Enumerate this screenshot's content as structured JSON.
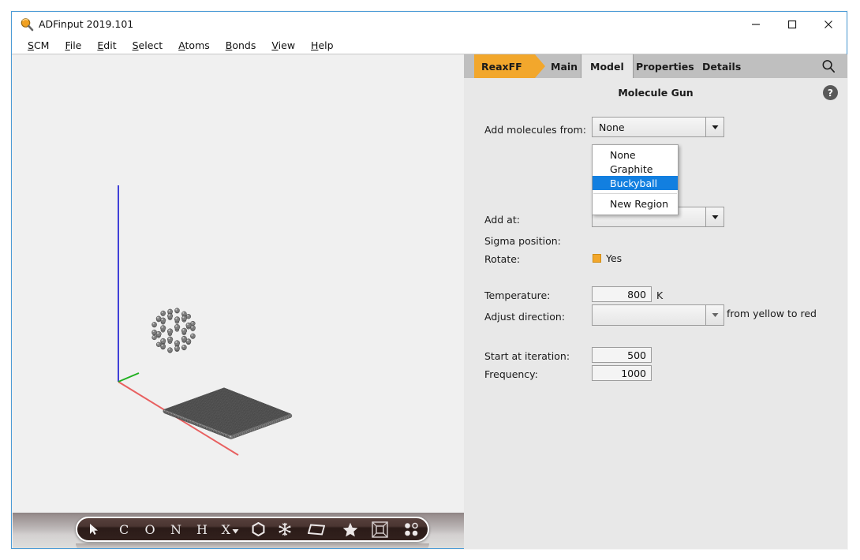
{
  "window": {
    "title": "ADFinput 2019.101",
    "icon": "magnifier-icon",
    "minimize_label": "–",
    "maximize_label": "□",
    "close_label": "✕"
  },
  "menubar": {
    "items": [
      {
        "label": "SCM",
        "mnemonic": "S"
      },
      {
        "label": "File",
        "mnemonic": "F"
      },
      {
        "label": "Edit",
        "mnemonic": "E"
      },
      {
        "label": "Select",
        "mnemonic": "S"
      },
      {
        "label": "Atoms",
        "mnemonic": "A"
      },
      {
        "label": "Bonds",
        "mnemonic": "B"
      },
      {
        "label": "View",
        "mnemonic": "V"
      },
      {
        "label": "Help",
        "mnemonic": "H"
      }
    ]
  },
  "tabs": {
    "module_label": "ReaxFF",
    "module_color": "#f2a72c",
    "items": [
      {
        "label": "Main",
        "active": false
      },
      {
        "label": "Model",
        "active": true
      },
      {
        "label": "Properties",
        "active": false
      },
      {
        "label": "Details",
        "active": false
      }
    ],
    "search_icon": "search-icon"
  },
  "panel": {
    "title": "Molecule Gun",
    "help_label": "?",
    "fields": {
      "add_molecules_from": {
        "label": "Add molecules from:",
        "value": "None"
      },
      "add_at": {
        "label": "Add at:",
        "value": ""
      },
      "sigma_position": {
        "label": "Sigma position:",
        "value": ""
      },
      "rotate": {
        "label": "Rotate:",
        "value": "Yes",
        "checked": true,
        "check_color": "#f2a72c"
      },
      "temperature": {
        "label": "Temperature:",
        "value": "800",
        "unit": "K"
      },
      "adjust_direction": {
        "label": "Adjust direction:",
        "value": "",
        "hint": "from yellow to red"
      },
      "start_at_iteration": {
        "label": "Start at iteration:",
        "value": "500"
      },
      "frequency": {
        "label": "Frequency:",
        "value": "1000"
      }
    }
  },
  "dropdown": {
    "open": true,
    "highlight_color": "#127fe0",
    "options": [
      {
        "label": "None",
        "selected": false
      },
      {
        "label": "Graphite",
        "selected": false
      },
      {
        "label": "Buckyball",
        "selected": true
      },
      {
        "label": "New Region",
        "selected": false,
        "after_separator": true
      }
    ]
  },
  "toolbar": {
    "buttons": [
      {
        "name": "select-cursor-icon",
        "label": "➤"
      },
      {
        "name": "element-c-button",
        "label": "C"
      },
      {
        "name": "element-o-button",
        "label": "O"
      },
      {
        "name": "element-n-button",
        "label": "N"
      },
      {
        "name": "element-h-button",
        "label": "H"
      },
      {
        "name": "element-x-dropdown-button",
        "label": "X"
      },
      {
        "name": "ring-hexagon-icon",
        "label": "⬡"
      },
      {
        "name": "snowflake-icon",
        "label": "✸"
      },
      {
        "name": "plane-parallelogram-icon",
        "label": "▱"
      },
      {
        "name": "star-icon",
        "label": "★"
      },
      {
        "name": "lattice-box-icon",
        "label": "▣"
      },
      {
        "name": "regions-dots-icon",
        "label": "⁙"
      }
    ]
  },
  "viewport": {
    "axes": [
      {
        "name": "z-axis",
        "color": "#3a3ad0"
      },
      {
        "name": "y-axis",
        "color": "#18a018"
      },
      {
        "name": "x-axis",
        "color": "#e05555"
      }
    ],
    "objects": [
      {
        "name": "buckyball-molecule",
        "type": "fullerene"
      },
      {
        "name": "graphene-sheet",
        "type": "slab"
      }
    ],
    "background": "#f0f0f0"
  }
}
